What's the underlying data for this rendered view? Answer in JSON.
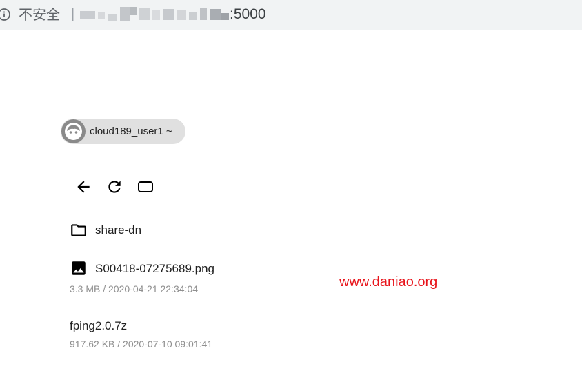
{
  "browser": {
    "security_label": "不安全",
    "separator": "|",
    "url_port": ":5000",
    "icon": "info-icon"
  },
  "user": {
    "name": "cloud189_user1 ~",
    "icon": "avatar-icon"
  },
  "toolbar": {
    "buttons": [
      {
        "icon": "arrow-back-icon"
      },
      {
        "icon": "refresh-icon"
      },
      {
        "icon": "crop-landscape-icon"
      }
    ]
  },
  "files": [
    {
      "name": "share-dn",
      "icon": "folder-icon",
      "meta": ""
    },
    {
      "name": "S00418-07275689.png",
      "icon": "image-icon",
      "meta": "3.3 MB / 2020-04-21 22:34:04"
    },
    {
      "name": "fping2.0.7z",
      "icon": "",
      "meta": "917.62 KB / 2020-07-10 09:01:41"
    }
  ],
  "watermark": "www.daniao.org",
  "colors": {
    "watermark": "#e8141b",
    "chip_background": "#e0e0e0",
    "address_bar": "#f1f3f4",
    "meta_text": "#8f8f8f"
  }
}
